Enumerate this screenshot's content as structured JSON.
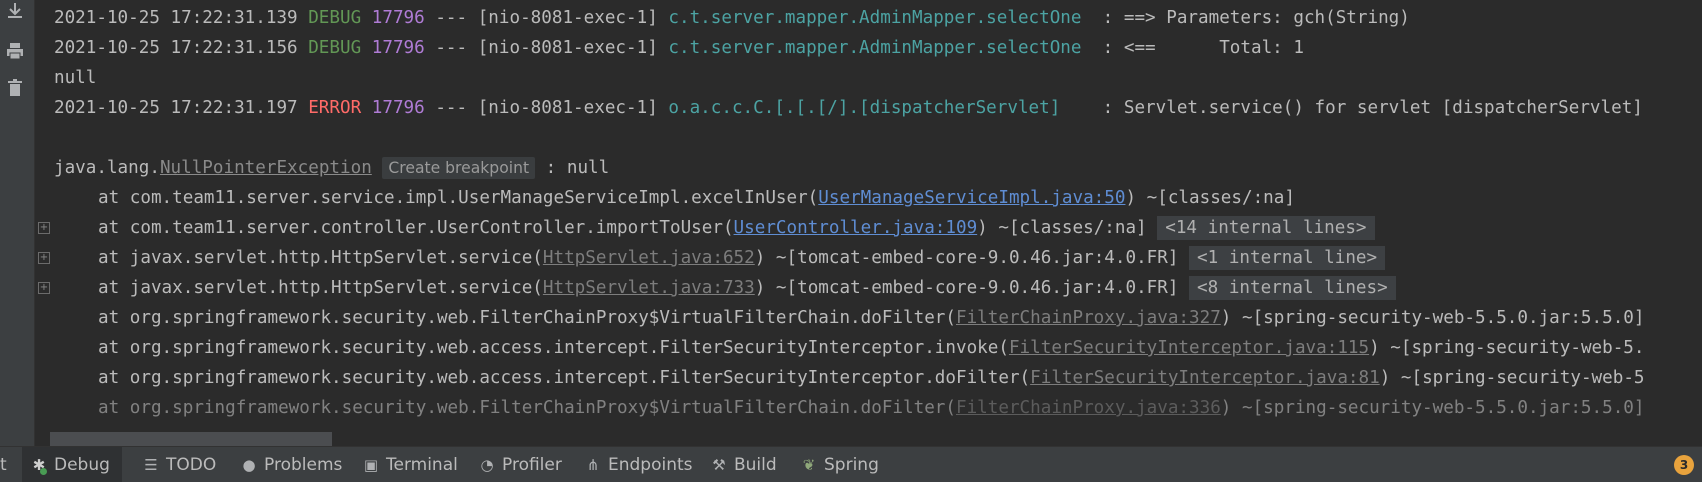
{
  "console": {
    "lines": [
      {
        "ts": "2021-10-25 17:22:31.139",
        "level": "DEBUG",
        "pid": "17796",
        "sep": "---",
        "thread": "[nio-8081-exec-1]",
        "logger": "c.t.server.mapper.AdminMapper.selectOne",
        "msg": "  : ==> Parameters: gch(String)"
      },
      {
        "ts": "2021-10-25 17:22:31.156",
        "level": "DEBUG",
        "pid": "17796",
        "sep": "---",
        "thread": "[nio-8081-exec-1]",
        "logger": "c.t.server.mapper.AdminMapper.selectOne",
        "msg": "  : <==      Total: 1"
      },
      {
        "text": "null"
      },
      {
        "ts": "2021-10-25 17:22:31.197",
        "level": "ERROR",
        "pid": "17796",
        "sep": "---",
        "thread": "[nio-8081-exec-1]",
        "logger": "o.a.c.c.C.[.[.[/].[dispatcherServlet]",
        "msg": "    : Servlet.service() for servlet [dispatcherServlet]"
      }
    ],
    "exception": {
      "prefix": "java.lang.",
      "name": "NullPointerException",
      "breakpoint": "Create breakpoint",
      "suffix": ": null"
    },
    "stack": [
      {
        "pre": "at com.team11.server.service.impl.UserManageServiceImpl.excelInUser(",
        "link": "UserManageServiceImpl.java:50",
        "post": ") ~[classes/:na]",
        "chip": ""
      },
      {
        "pre": "at com.team11.server.controller.UserController.importToUser(",
        "link": "UserController.java:109",
        "post": ") ~[classes/:na]",
        "chip": "<14 internal lines>"
      },
      {
        "pre": "at javax.servlet.http.HttpServlet.service(",
        "link": "HttpServlet.java:652",
        "post": ") ~[tomcat-embed-core-9.0.46.jar:4.0.FR]",
        "chip": "<1 internal line>"
      },
      {
        "pre": "at javax.servlet.http.HttpServlet.service(",
        "link": "HttpServlet.java:733",
        "post": ") ~[tomcat-embed-core-9.0.46.jar:4.0.FR]",
        "chip": "<8 internal lines>"
      },
      {
        "pre": "at org.springframework.security.web.FilterChainProxy$VirtualFilterChain.doFilter(",
        "link": "FilterChainProxy.java:327",
        "post": ") ~[spring-security-web-5.5.0.jar:5.5.0]",
        "chip": ""
      },
      {
        "pre": "at org.springframework.security.web.access.intercept.FilterSecurityInterceptor.invoke(",
        "link": "FilterSecurityInterceptor.java:115",
        "post": ") ~[spring-security-web-5.",
        "chip": ""
      },
      {
        "pre": "at org.springframework.security.web.access.intercept.FilterSecurityInterceptor.doFilter(",
        "link": "FilterSecurityInterceptor.java:81",
        "post": ") ~[spring-security-web-5",
        "chip": ""
      },
      {
        "pre": "at org.springframework.security.web.FilterChainProxy$VirtualFilterChain.doFilter(",
        "link": "FilterChainProxy.java:336",
        "post": ") ~[spring-security-web-5.5.0.jar:5.5.0]",
        "chip": ""
      }
    ]
  },
  "gutter_icons": [
    "download-icon",
    "print-icon",
    "trash-icon"
  ],
  "toolbar": {
    "cut_label": "t",
    "tabs": [
      {
        "label": "Debug",
        "icon": "bug-icon",
        "active": true
      },
      {
        "label": "TODO",
        "icon": "list-icon",
        "active": false
      },
      {
        "label": "Problems",
        "icon": "warning-icon",
        "active": false
      },
      {
        "label": "Terminal",
        "icon": "terminal-icon",
        "active": false
      },
      {
        "label": "Profiler",
        "icon": "profiler-icon",
        "active": false
      },
      {
        "label": "Endpoints",
        "icon": "endpoints-icon",
        "active": false
      },
      {
        "label": "Build",
        "icon": "hammer-icon",
        "active": false
      },
      {
        "label": "Spring",
        "icon": "leaf-icon",
        "active": false
      }
    ],
    "badge": "3"
  },
  "colors": {
    "background": "#2b2b2b",
    "debug": "#629755",
    "error": "#ff6b68",
    "pid": "#b07cd6",
    "logger": "#4ca3a3",
    "link": "#5f8dd3"
  }
}
